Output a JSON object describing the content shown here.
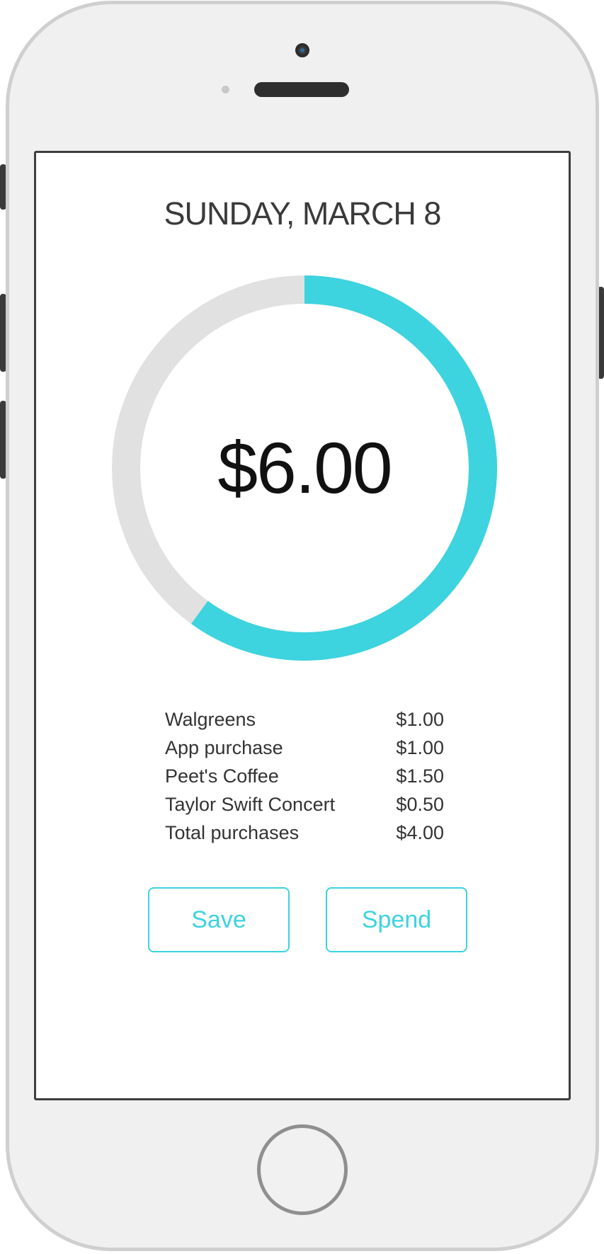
{
  "header": {
    "date": "SUNDAY, MARCH 8"
  },
  "balance": {
    "amount": "$6.00",
    "ring_progress": 0.6,
    "ring_color": "#3dd3df",
    "ring_track_color": "#e1e1e1"
  },
  "purchases": [
    {
      "name": "Walgreens",
      "amount": "$1.00"
    },
    {
      "name": "App purchase",
      "amount": "$1.00"
    },
    {
      "name": "Peet's Coffee",
      "amount": "$1.50"
    },
    {
      "name": "Taylor Swift Concert",
      "amount": "$0.50"
    },
    {
      "name": "Total purchases",
      "amount": "$4.00"
    }
  ],
  "actions": {
    "save_label": "Save",
    "spend_label": "Spend"
  },
  "colors": {
    "accent": "#3dd3df",
    "text": "#333333"
  }
}
